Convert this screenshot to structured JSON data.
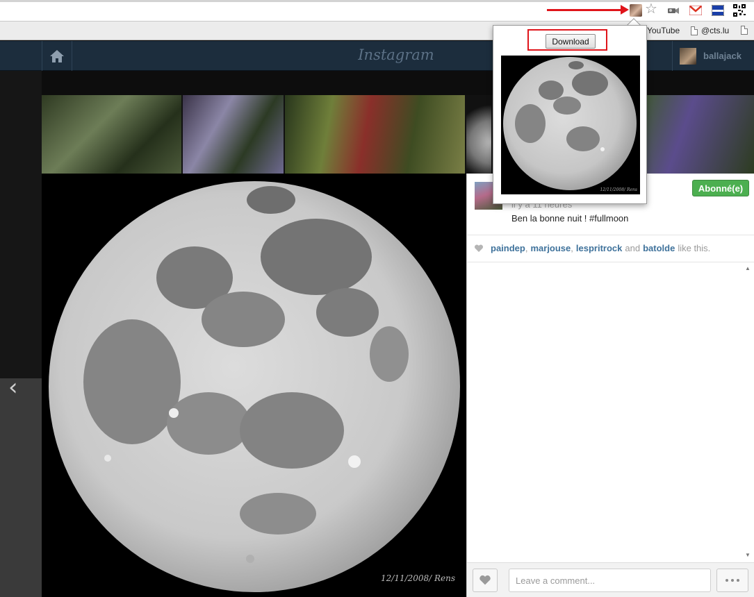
{
  "browser": {
    "bookmarks": [
      {
        "label": "YouTube"
      },
      {
        "label": "@cts.lu"
      }
    ],
    "extensions": [
      "instagram-downloader-avatar-icon",
      "bookmark-star-icon",
      "camera-icon",
      "gmail-icon",
      "flag-icon",
      "qr-code-icon"
    ],
    "accent_arrow_color": "#e0141a"
  },
  "popup": {
    "download_label": "Download",
    "image_signature": "12/11/2008/ Rens"
  },
  "instagram": {
    "logo": "Instagram",
    "username": "ballajack",
    "post": {
      "time": "il y a 11 heures",
      "caption": "Ben la bonne nuit ! #fullmoon",
      "follow_label": "Abonné(e)",
      "signature": "12/11/2008/ Rens",
      "likers": [
        "paindep",
        "marjouse",
        "lespritrock",
        "batolde"
      ],
      "likes_suffix": "like this.",
      "and_word": "and",
      "comma": ","
    },
    "comment_placeholder": "Leave a comment...",
    "colors": {
      "header": "#1c2d3d",
      "follow": "#4caf50",
      "liker": "#3f729b"
    }
  }
}
